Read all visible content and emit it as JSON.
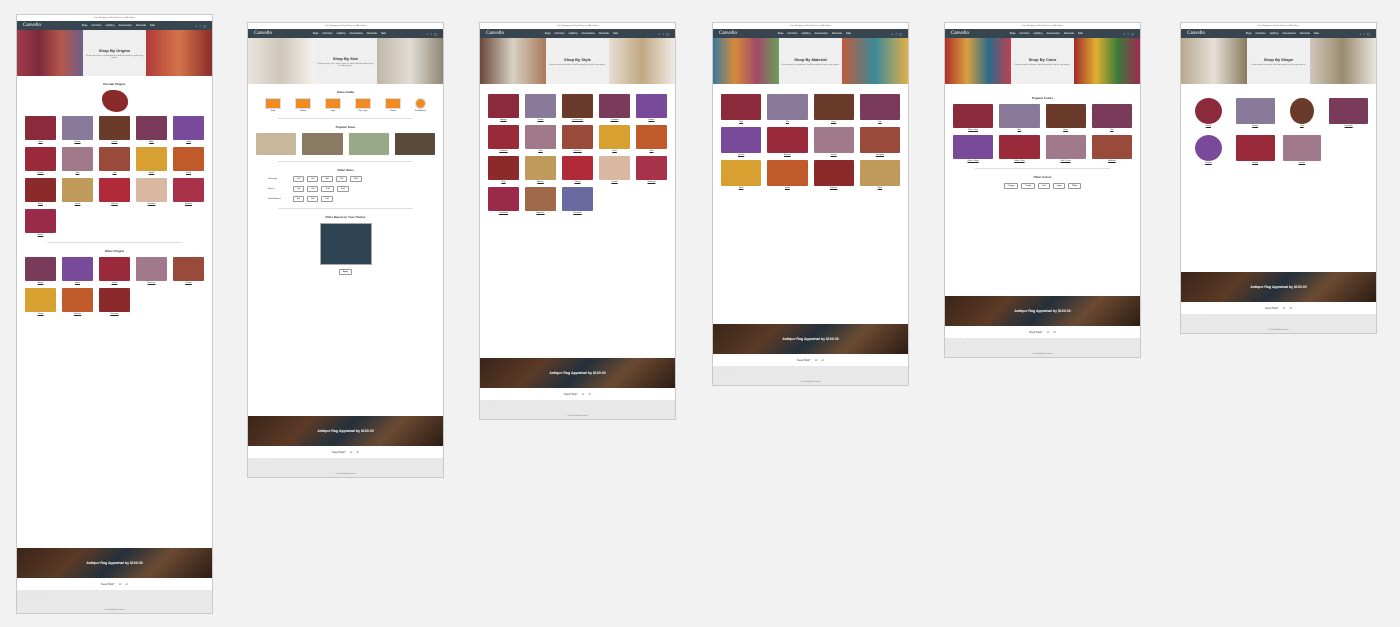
{
  "common": {
    "logo": "Canvello",
    "announce": "Free Shipping and Free Returns on All Orders",
    "menu": [
      "Rugs",
      "Furniture",
      "Lighting",
      "Accessories",
      "Decorate",
      "Sale"
    ],
    "banner": "Antique Rug Appraisal by $100.00",
    "need_help": "Need Help?",
    "copyright": "© Canvello. All rights reserved."
  },
  "pages": [
    {
      "hero_title": "Shop By Origins",
      "hero_sub": "From classical to contemporary, find the perfect rug for any space.",
      "section1": "Persian Origins",
      "section2": "Other Origins",
      "items1": [
        "Heriz",
        "Kashan",
        "Isfahan",
        "Bidjar",
        "Tabriz",
        "Kerman",
        "Nain",
        "Qum",
        "Ardabil",
        "Kazak",
        "Mahal",
        "Sarouk",
        "Mashad",
        "Hamadan",
        "Bakhtiari",
        "Baluch"
      ],
      "items2": [
        "Afghan",
        "Indian",
        "Turkish",
        "Moroccan",
        "Chinese",
        "Tibetan",
        "Pakistani",
        "Caucasian"
      ]
    },
    {
      "hero_title": "Shop By Size",
      "hero_sub": "Using a rugs size, and a style or color, find the perfect rug for any space.",
      "section1": "Sizes Guide",
      "section2": "Popular Sizes",
      "section3": "Other Sizes",
      "section4": "Filter Based on Your Choice",
      "guide": [
        "Small",
        "Medium",
        "Large",
        "Extra Large",
        "Runner",
        "Round/Square"
      ],
      "size_rows": [
        {
          "label": "Rectangle",
          "sizes": [
            "2x3",
            "3x5",
            "4x6",
            "5x8",
            "8x10"
          ]
        },
        {
          "label": "Runner",
          "sizes": [
            "2x6",
            "2x8",
            "2x10",
            "3x12"
          ]
        },
        {
          "label": "Round/Square",
          "sizes": [
            "4x4",
            "6x6",
            "8x8"
          ]
        }
      ],
      "apply": "Apply"
    },
    {
      "hero_title": "Shop By Style",
      "hero_sub": "From classic to modern, find the perfect rug for any space.",
      "items": [
        "Antique",
        "Vintage",
        "Contemporary",
        "Overdyed",
        "Modern",
        "Traditional",
        "Tribal",
        "Geometric",
        "Floral",
        "Kilim",
        "Shag",
        "Abstract",
        "Persian",
        "Oriental",
        "Moroccan",
        "Transitional",
        "Bohemian",
        "Patchwork"
      ]
    },
    {
      "hero_title": "Shop By Material",
      "hero_sub": "From natural to synthetic, find the perfect rug for any space.",
      "items": [
        "Wool",
        "Silk",
        "Cotton",
        "Jute",
        "Viscose",
        "Bamboo",
        "Leather",
        "Sheepskin",
        "Blend",
        "Hemp",
        "Polyester",
        "Nylon"
      ]
    },
    {
      "hero_title": "Shop By Color",
      "hero_sub": "From neutral to vibrant, find the perfect rug for any space.",
      "section1": "Popular Colors",
      "section2": "Other Colors",
      "items": [
        "Black / Gray",
        "Blue",
        "Green",
        "Red",
        "Brown / Beige",
        "Yellow / Gold",
        "Pink / Purple",
        "Multicolor"
      ],
      "other": [
        "Orange",
        "Purple",
        "Teal",
        "Ivory",
        "White"
      ]
    },
    {
      "hero_title": "Shop By Shape",
      "hero_sub": "From round to runner, find the perfect rug for any space.",
      "items": [
        "Round",
        "Runner",
        "Oval",
        "Rectangle",
        "Octagon",
        "Square",
        "Irregular"
      ]
    }
  ]
}
